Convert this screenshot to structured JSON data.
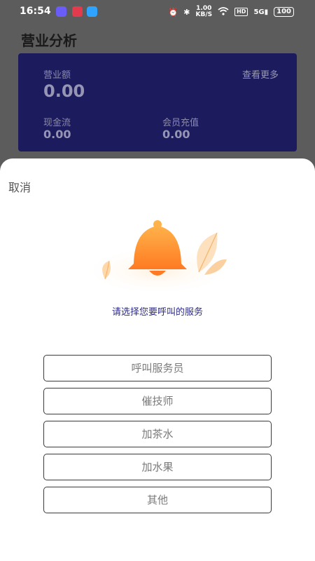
{
  "status_bar": {
    "time": "16:54",
    "net_speed": "1.00",
    "net_unit": "KB/S",
    "hd": "HD",
    "signal": "5G",
    "battery": "100"
  },
  "page": {
    "title": "营业分析"
  },
  "stats": {
    "revenue_label": "营业额",
    "revenue_value": "0.00",
    "more_label": "查看更多",
    "cash_label": "现金流",
    "cash_value": "0.00",
    "member_label": "会员充值",
    "member_value": "0.00"
  },
  "sheet": {
    "cancel_label": "取消",
    "prompt": "请选择您要呼叫的服务",
    "options": [
      {
        "label": "呼叫服务员"
      },
      {
        "label": "催技师"
      },
      {
        "label": "加茶水"
      },
      {
        "label": "加水果"
      },
      {
        "label": "其他"
      }
    ]
  },
  "colors": {
    "card_bg": "#1c1b5e",
    "prompt_text": "#2d2a87",
    "bell_orange": "#ff8a2b"
  }
}
